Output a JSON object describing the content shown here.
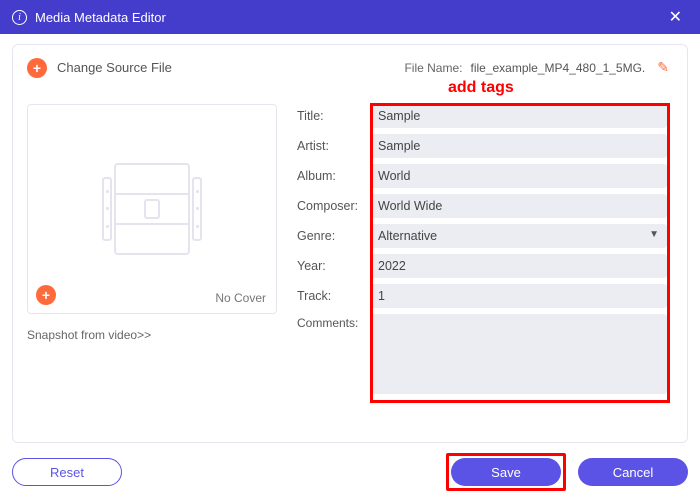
{
  "titlebar": {
    "title": "Media Metadata Editor"
  },
  "source": {
    "change_label": "Change Source File",
    "filename_label": "File Name:",
    "filename_value": "file_example_MP4_480_1_5MG."
  },
  "annotation": {
    "add_tags": "add tags"
  },
  "preview": {
    "no_cover": "No Cover",
    "snapshot_link": "Snapshot from video>>"
  },
  "fields": {
    "title_label": "Title:",
    "title_value": "Sample",
    "artist_label": "Artist:",
    "artist_value": "Sample",
    "album_label": "Album:",
    "album_value": "World",
    "composer_label": "Composer:",
    "composer_value": "World Wide",
    "genre_label": "Genre:",
    "genre_value": "Alternative",
    "year_label": "Year:",
    "year_value": "2022",
    "track_label": "Track:",
    "track_value": "1",
    "comments_label": "Comments:",
    "comments_value": ""
  },
  "footer": {
    "reset": "Reset",
    "save": "Save",
    "cancel": "Cancel"
  }
}
